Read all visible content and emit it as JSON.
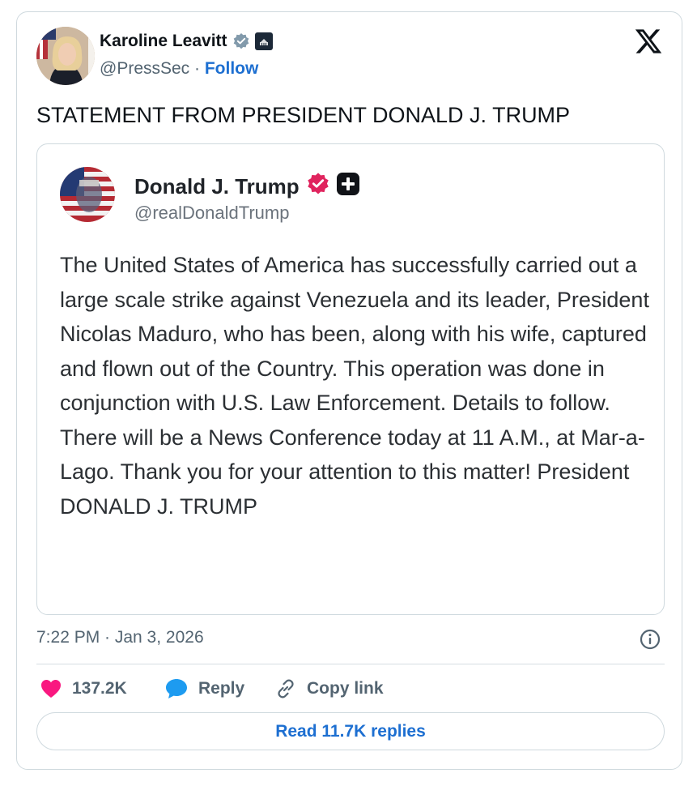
{
  "author": {
    "name": "Karoline Leavitt",
    "handle": "@PressSec",
    "separator": " · ",
    "follow_label": "Follow"
  },
  "tweet_text": "STATEMENT FROM PRESIDENT DONALD J. TRUMP",
  "quoted_post": {
    "name": "Donald J. Trump",
    "handle": "@realDonaldTrump",
    "body": "The United States of America has successfully carried out a large scale strike against Venezuela and its leader, President Nicolas Maduro, who has been, along with his wife, captured and flown out of the Country. This operation was done in conjunction with U.S. Law Enforcement. Details to follow. There will be a News Conference today at 11 A.M., at Mar-a-Lago. Thank you for your attention to this matter! President DONALD J. TRUMP"
  },
  "timestamp": "7:22 PM · Jan 3, 2026",
  "actions": {
    "like_count": "137.2K",
    "reply_label": "Reply",
    "copy_label": "Copy link"
  },
  "read_replies_label": "Read 11.7K replies",
  "icons": {
    "x_logo": "x-logo-icon",
    "verified": "verified-badge-icon",
    "like": "heart-icon",
    "reply": "speech-bubble-icon",
    "copy": "link-icon",
    "info": "info-icon",
    "plus_badge": "plus-badge-icon"
  },
  "colors": {
    "like": "#f91880",
    "reply": "#1d9bf0",
    "link_blue": "#1d6fd1",
    "verified_gray": "#829aab",
    "verified_pink": "#e0245e",
    "text_secondary": "#536471",
    "border": "#cfd9de"
  }
}
